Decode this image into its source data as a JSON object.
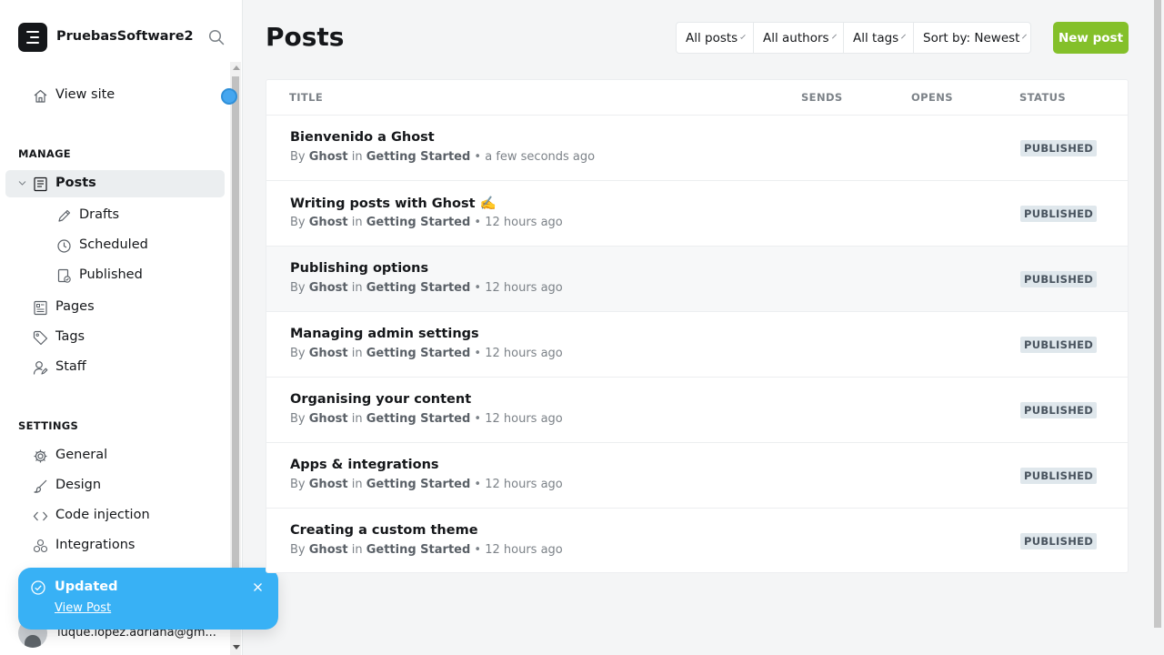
{
  "sidebar": {
    "site_name": "PruebasSoftware2",
    "view_site": "View site",
    "manage_label": "MANAGE",
    "settings_label": "SETTINGS",
    "manage_items": [
      {
        "label": "Posts"
      },
      {
        "label": "Drafts"
      },
      {
        "label": "Scheduled"
      },
      {
        "label": "Published"
      },
      {
        "label": "Pages"
      },
      {
        "label": "Tags"
      },
      {
        "label": "Staff"
      }
    ],
    "settings_items": [
      {
        "label": "General"
      },
      {
        "label": "Design"
      },
      {
        "label": "Code injection"
      },
      {
        "label": "Integrations"
      }
    ],
    "user_email": "luque.lopez.adriana@gm..."
  },
  "toast": {
    "title": "Updated",
    "link": "View Post"
  },
  "main": {
    "title": "Posts",
    "filters": [
      "All posts",
      "All authors",
      "All tags",
      "Sort by: Newest"
    ],
    "new_post": "New post",
    "columns": {
      "title": "TITLE",
      "sends": "SENDS",
      "opens": "OPENS",
      "status": "STATUS"
    },
    "posts": [
      {
        "title": "Bienvenido a Ghost",
        "by": "By",
        "author": "Ghost",
        "in": "in",
        "tag": "Getting Started",
        "time": "• a few seconds ago",
        "status": "PUBLISHED"
      },
      {
        "title": "Writing posts with Ghost ✍️",
        "by": "By",
        "author": "Ghost",
        "in": "in",
        "tag": "Getting Started",
        "time": "• 12 hours ago",
        "status": "PUBLISHED"
      },
      {
        "title": "Publishing options",
        "by": "By",
        "author": "Ghost",
        "in": "in",
        "tag": "Getting Started",
        "time": "• 12 hours ago",
        "status": "PUBLISHED"
      },
      {
        "title": "Managing admin settings",
        "by": "By",
        "author": "Ghost",
        "in": "in",
        "tag": "Getting Started",
        "time": "• 12 hours ago",
        "status": "PUBLISHED"
      },
      {
        "title": "Organising your content",
        "by": "By",
        "author": "Ghost",
        "in": "in",
        "tag": "Getting Started",
        "time": "• 12 hours ago",
        "status": "PUBLISHED"
      },
      {
        "title": "Apps & integrations",
        "by": "By",
        "author": "Ghost",
        "in": "in",
        "tag": "Getting Started",
        "time": "• 12 hours ago",
        "status": "PUBLISHED"
      },
      {
        "title": "Creating a custom theme",
        "by": "By",
        "author": "Ghost",
        "in": "in",
        "tag": "Getting Started",
        "time": "• 12 hours ago",
        "status": "PUBLISHED"
      }
    ]
  },
  "colors": {
    "accent_green": "#84c02a",
    "toast_blue": "#38b1f5",
    "text_dark": "#15171a",
    "text_muted": "#7c8288"
  },
  "icons": [
    "ghost-logo-icon",
    "search-icon",
    "home-icon",
    "posts-icon",
    "pencil-icon",
    "clock-icon",
    "published-icon",
    "pages-icon",
    "tag-icon",
    "staff-icon",
    "gear-icon",
    "brush-icon",
    "code-icon",
    "integrations-icon",
    "check-circle-icon",
    "close-icon",
    "chevron-down-icon"
  ]
}
